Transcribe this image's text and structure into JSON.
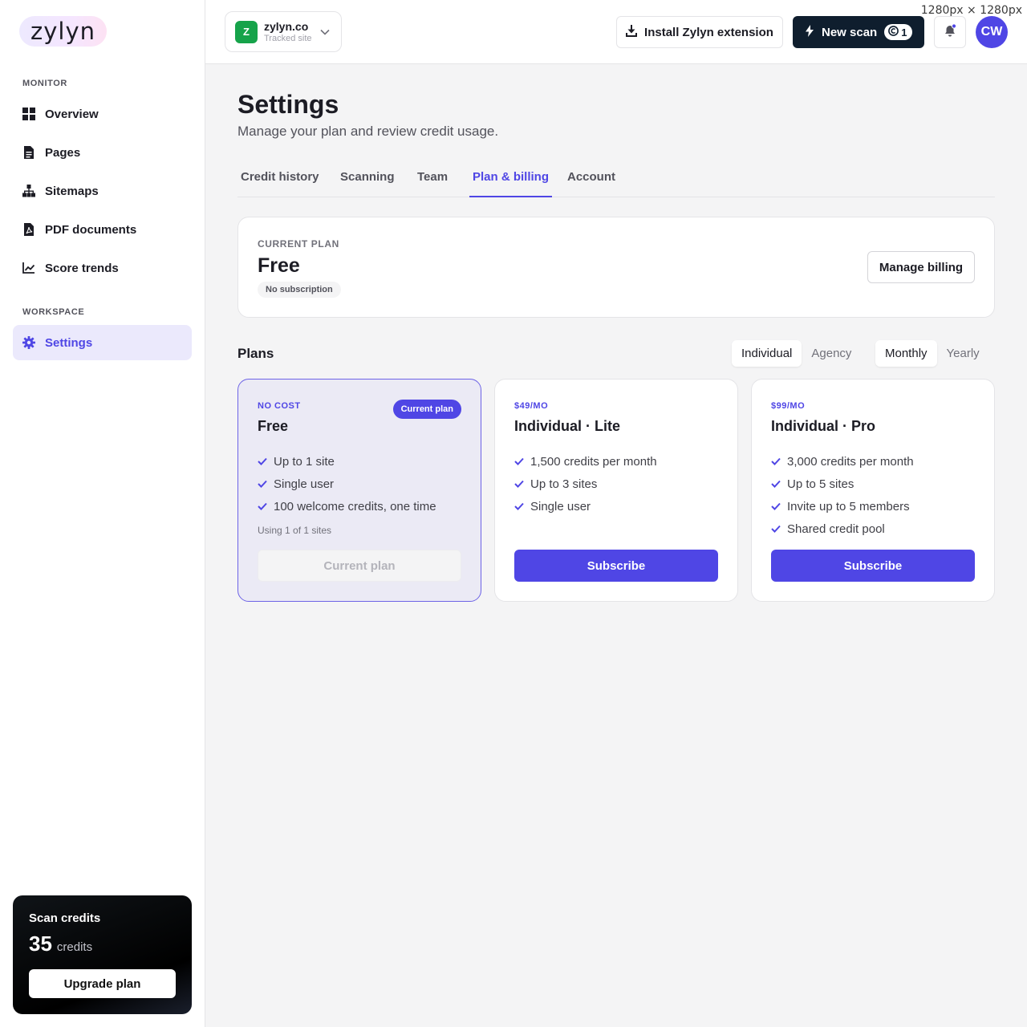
{
  "dimension_label": "1280px × 1280px",
  "app": {
    "logo_text": "zylyn"
  },
  "sidebar": {
    "sections": [
      {
        "title": "MONITOR"
      },
      {
        "title": "WORKSPACE"
      }
    ],
    "items": [
      {
        "label": "Overview",
        "icon": "grid-icon"
      },
      {
        "label": "Pages",
        "icon": "document-icon"
      },
      {
        "label": "Sitemaps",
        "icon": "sitemap-icon"
      },
      {
        "label": "PDF documents",
        "icon": "pdf-icon"
      },
      {
        "label": "Score trends",
        "icon": "trend-chart-icon"
      },
      {
        "label": "Settings",
        "icon": "gear-icon",
        "active": true
      }
    ],
    "credits": {
      "title": "Scan credits",
      "amount": "35",
      "unit": "credits",
      "upgrade_label": "Upgrade plan"
    }
  },
  "topbar": {
    "site": {
      "badge": "Z",
      "name": "zylyn.co",
      "subtitle": "Tracked site"
    },
    "install_label": "Install Zylyn extension",
    "new_scan_label": "New scan",
    "scan_count": "1",
    "avatar_initials": "CW"
  },
  "page": {
    "title": "Settings",
    "subtitle": "Manage your plan and review credit usage."
  },
  "tabs": [
    {
      "label": "Credit history"
    },
    {
      "label": "Scanning"
    },
    {
      "label": "Team"
    },
    {
      "label": "Plan & billing",
      "active": true
    },
    {
      "label": "Account"
    }
  ],
  "current_plan": {
    "label": "CURRENT PLAN",
    "name": "Free",
    "badge": "No subscription",
    "manage_label": "Manage billing"
  },
  "plans": {
    "heading": "Plans",
    "audience_options": [
      "Individual",
      "Agency"
    ],
    "audience_selected": "Individual",
    "billing_options": [
      "Monthly",
      "Yearly"
    ],
    "billing_selected": "Monthly",
    "cards": [
      {
        "price": "NO COST",
        "name": "Free",
        "badge": "Current plan",
        "features": [
          "Up to 1 site",
          "Single user",
          "100 welcome credits, one time"
        ],
        "usage": "Using 1 of 1 sites",
        "button": "Current plan",
        "is_current": true
      },
      {
        "price": "$49/MO",
        "name": "Individual · Lite",
        "features": [
          "1,500 credits per month",
          "Up to 3 sites",
          "Single user"
        ],
        "button": "Subscribe"
      },
      {
        "price": "$99/MO",
        "name": "Individual · Pro",
        "features": [
          "3,000 credits per month",
          "Up to 5 sites",
          "Invite up to 5 members",
          "Shared credit pool"
        ],
        "button": "Subscribe"
      }
    ]
  },
  "colors": {
    "accent": "#4f46e5",
    "dark_button": "#0f1e2e",
    "site_badge": "#16a34a"
  }
}
